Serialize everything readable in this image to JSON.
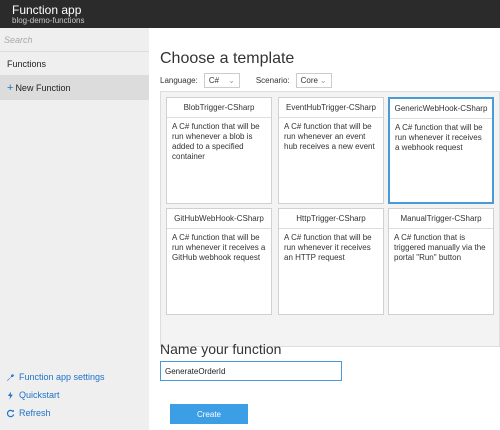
{
  "header": {
    "title": "Function app",
    "subtitle": "blog-demo-functions"
  },
  "sidebar": {
    "search_placeholder": "Search",
    "functions_label": "Functions",
    "new_function_label": "New Function",
    "links": [
      {
        "label": "Function app settings",
        "icon": "wrench-icon"
      },
      {
        "label": "Quickstart",
        "icon": "lightning-icon"
      },
      {
        "label": "Refresh",
        "icon": "refresh-icon"
      }
    ]
  },
  "main": {
    "heading": "Choose a template",
    "language_label": "Language:",
    "language_value": "C#",
    "scenario_label": "Scenario:",
    "scenario_value": "Core",
    "templates": [
      {
        "title": "BlobTrigger-CSharp",
        "desc": "A C# function that will be run whenever a blob is added to a specified container",
        "selected": false
      },
      {
        "title": "EventHubTrigger-CSharp",
        "desc": "A C# function that will be run whenever an event hub receives a new event",
        "selected": false
      },
      {
        "title": "GenericWebHook-CSharp",
        "desc": "A C# function that will be run whenever it receives a webhook request",
        "selected": true
      },
      {
        "title": "GitHubWebHook-CSharp",
        "desc": "A C# function that will be run whenever it receives a GitHub webhook request",
        "selected": false
      },
      {
        "title": "HttpTrigger-CSharp",
        "desc": "A C# function that will be run whenever it receives an HTTP request",
        "selected": false
      },
      {
        "title": "ManualTrigger-CSharp",
        "desc": "A C# function that is triggered manually via the portal \"Run\" button",
        "selected": false
      }
    ],
    "name_heading": "Name your function",
    "name_value": "GenerateOrderId",
    "create_label": "Create"
  },
  "colors": {
    "header_bg": "#2b2b2b",
    "accent": "#3c9ee5",
    "selected_border": "#4a9ad8",
    "link": "#1e72c9"
  }
}
